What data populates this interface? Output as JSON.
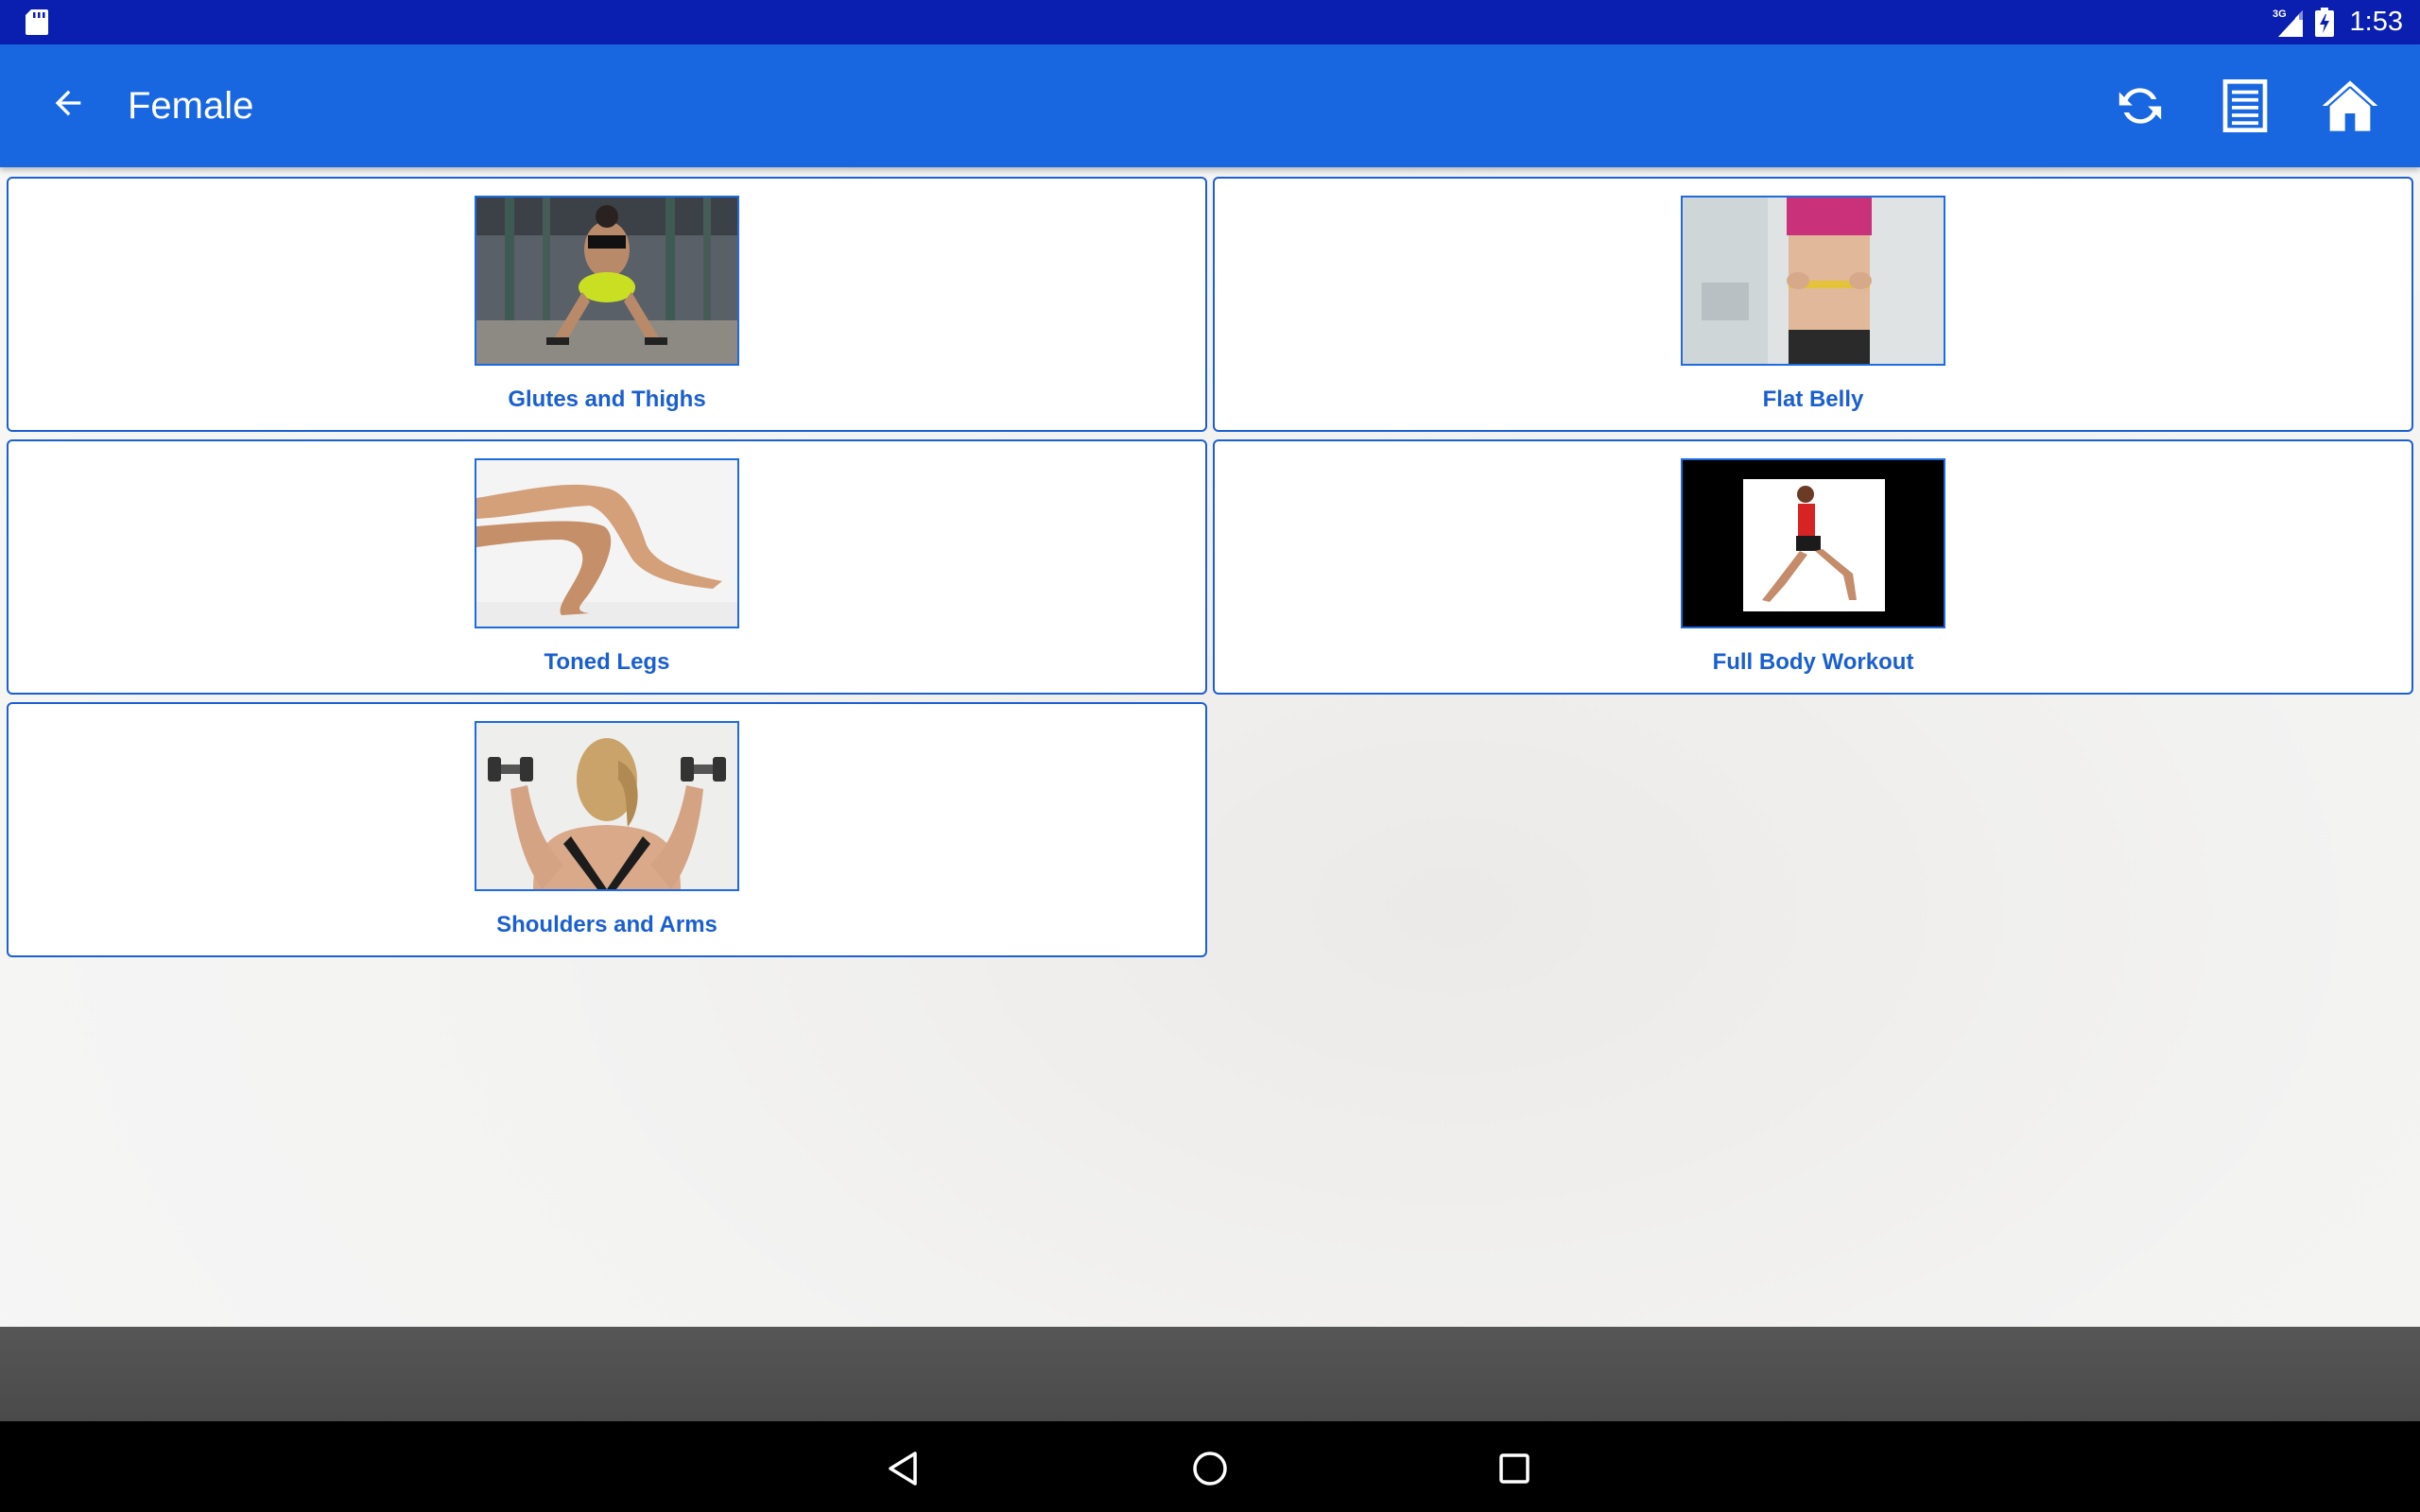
{
  "status_bar": {
    "network": "3G",
    "time": "1:53"
  },
  "app_bar": {
    "title": "Female",
    "back_icon": "arrow-back-icon",
    "actions": [
      {
        "icon": "refresh-icon"
      },
      {
        "icon": "list-icon"
      },
      {
        "icon": "home-icon"
      }
    ]
  },
  "categories": [
    {
      "label": "Glutes and Thighs",
      "image": "glutes-thighs-photo"
    },
    {
      "label": "Flat Belly",
      "image": "flat-belly-photo"
    },
    {
      "label": "Toned Legs",
      "image": "toned-legs-photo"
    },
    {
      "label": "Full Body Workout",
      "image": "full-body-workout-photo"
    },
    {
      "label": "Shoulders and Arms",
      "image": "shoulders-arms-photo"
    }
  ],
  "nav_bar": {
    "buttons": [
      "back-icon",
      "home-icon",
      "recents-icon"
    ]
  },
  "colors": {
    "status_bar": "#0a1fb0",
    "app_bar": "#1967e0",
    "accent": "#1a5fcf",
    "card_border": "#1b5fd1"
  }
}
